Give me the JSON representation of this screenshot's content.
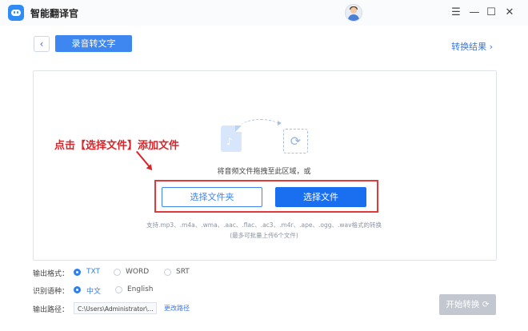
{
  "app": {
    "title": "智能翻译官"
  },
  "window_controls": {
    "menu": "☰",
    "minimize": "—",
    "maximize": "☐",
    "close": "✕"
  },
  "header": {
    "back_icon": "chevron-left",
    "back_glyph": "‹",
    "title": "录音转文字",
    "result_link": "转换结果 ›"
  },
  "drop_area": {
    "hint": "将音频文件拖拽至此区域，或",
    "select_folder_label": "选择文件夹",
    "select_file_label": "选择文件",
    "supported_formats": "支持.mp3、.m4a、.wma、.aac、.flac、.ac3、.m4r、.ape、.ogg、.wav格式的转换",
    "max_note": "(最多可批量上传6个文件)",
    "note_glyph": "♪",
    "refresh_glyph": "⟳"
  },
  "annotation": {
    "text": "点击【选择文件】添加文件",
    "color": "#d7262b"
  },
  "options": {
    "output_format": {
      "label": "输出格式：",
      "choices": [
        "TXT",
        "WORD",
        "SRT"
      ],
      "selected": "TXT"
    },
    "language": {
      "label": "识别语种：",
      "choices": [
        "中文",
        "English"
      ],
      "selected": "中文"
    },
    "output_path": {
      "label": "输出路径：",
      "value": "C:\\Users\\Administrator\\...",
      "change_label": "更改路径"
    }
  },
  "start_button": {
    "label": "开始转换 ⟳",
    "enabled": false
  },
  "colors": {
    "accent": "#3e86f0",
    "primary_button": "#1a6ff0",
    "disabled": "#c3c8d0"
  }
}
